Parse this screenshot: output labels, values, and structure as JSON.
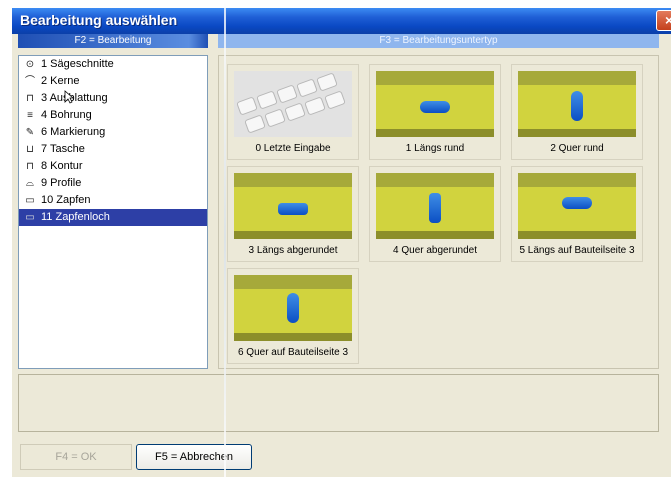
{
  "window": {
    "title": "Bearbeitung auswählen"
  },
  "headers": {
    "left": "F2 = Bearbeitung",
    "right": "F3 = Bearbeitungsuntertyp"
  },
  "list": {
    "items": [
      {
        "label": "1 Sägeschnitte",
        "icon": "saw-cut-icon"
      },
      {
        "label": "2 Kerne",
        "icon": "notch-icon"
      },
      {
        "label": "3 Ausblattung",
        "icon": "halving-icon"
      },
      {
        "label": "4 Bohrung",
        "icon": "drill-icon"
      },
      {
        "label": "6 Markierung",
        "icon": "pencil-icon"
      },
      {
        "label": "7 Tasche",
        "icon": "pocket-icon"
      },
      {
        "label": "8 Kontur",
        "icon": "contour-icon"
      },
      {
        "label": "9 Profile",
        "icon": "profile-icon"
      },
      {
        "label": "10 Zapfen",
        "icon": "tenon-icon"
      },
      {
        "label": "11 Zapfenloch",
        "icon": "mortise-icon",
        "selected": true
      }
    ]
  },
  "subtypes": [
    {
      "label": "0 Letzte Eingabe",
      "image": "keyboard"
    },
    {
      "label": "1 Längs rund",
      "image": "beam-slot-horizontal"
    },
    {
      "label": "2 Quer rund",
      "image": "beam-slot-vertical"
    },
    {
      "label": "3 Längs abgerundet",
      "image": "beam-slot-horizontal"
    },
    {
      "label": "4 Quer abgerundet",
      "image": "beam-slot-vertical"
    },
    {
      "label": "5 Längs auf Bauteilseite 3",
      "image": "beam-slot-horizontal"
    },
    {
      "label": "6 Quer auf Bauteilseite 3",
      "image": "beam-slot-vertical"
    }
  ],
  "buttons": {
    "ok": "F4 = OK",
    "cancel": "F5 = Abbrechen"
  },
  "colors": {
    "selection": "#2d3fa6",
    "beam": "#d1d33e",
    "slot": "#1f63d6"
  }
}
